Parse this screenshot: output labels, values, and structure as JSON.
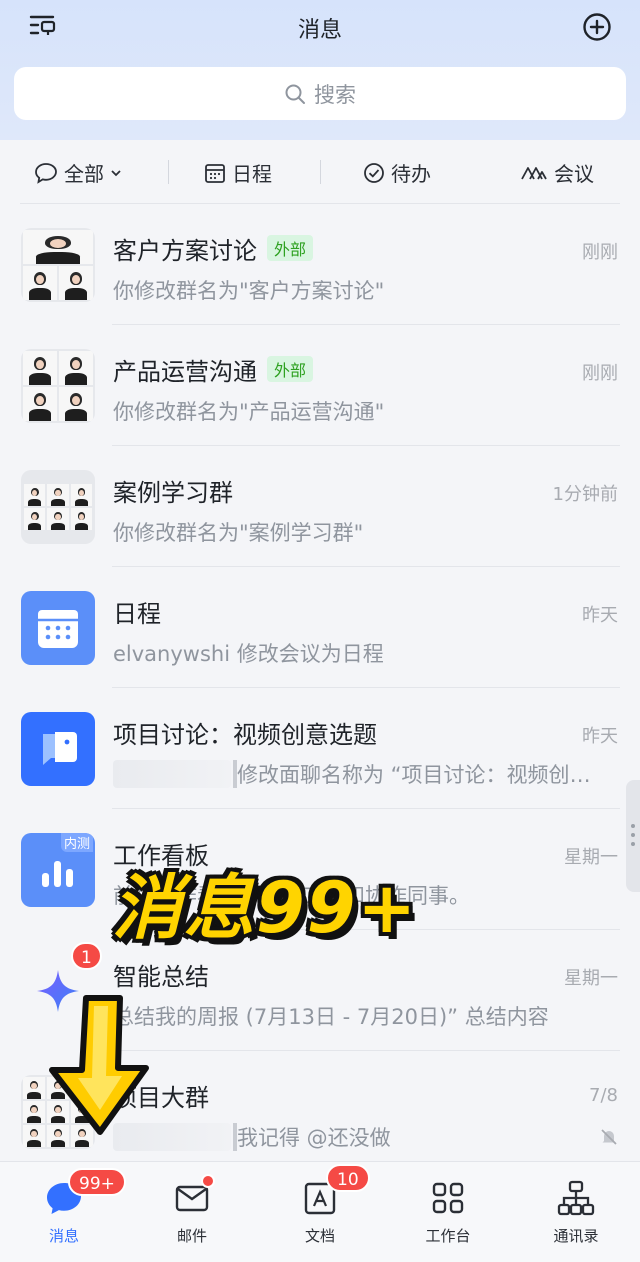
{
  "header": {
    "title": "消息",
    "search_placeholder": "搜索"
  },
  "filters": [
    {
      "label": "全部",
      "icon": "chat-bubble-icon"
    },
    {
      "label": "日程",
      "icon": "calendar-icon"
    },
    {
      "label": "待办",
      "icon": "check-circle-icon"
    },
    {
      "label": "会议",
      "icon": "meeting-icon"
    }
  ],
  "chats": [
    {
      "name": "客户方案讨论",
      "tag": "外部",
      "time": "刚刚",
      "preview": "你修改群名为\"客户方案讨论\""
    },
    {
      "name": "产品运营沟通",
      "tag": "外部",
      "time": "刚刚",
      "preview": "你修改群名为\"产品运营沟通\""
    },
    {
      "name": "案例学习群",
      "time": "1分钟前",
      "preview": "你修改群名为\"案例学习群\""
    },
    {
      "name": "日程",
      "time": "昨天",
      "preview": "elvanywshi 修改会议为日程"
    },
    {
      "name": "项目讨论：视频创意选题",
      "time": "昨天",
      "preview": "修改面聊名称为 “项目讨论：视频创意选题”"
    },
    {
      "name": "工作看板",
      "avatar_badge": "内测",
      "time": "星期一",
      "preview": "前往工作看板，了解工作和协作同事。"
    },
    {
      "name": "智能总结",
      "unread": "1",
      "time": "星期一",
      "preview": "总结我的周报 (7月13日 - 7月20日)” 总结内容"
    },
    {
      "name": "项目大群",
      "time": "7/8",
      "preview": "我记得 @还没做"
    }
  ],
  "overlay": {
    "promo_text": "消息99+"
  },
  "bottom_nav": [
    {
      "label": "消息",
      "badge": "99+",
      "active": true
    },
    {
      "label": "邮件",
      "dot": true
    },
    {
      "label": "文档",
      "badge": "10"
    },
    {
      "label": "工作台"
    },
    {
      "label": "通讯录"
    }
  ],
  "colors": {
    "accent": "#3370ff",
    "badge_red": "#f54a45",
    "external_tag_bg": "#d9f5e1",
    "external_tag_text": "#2ea121",
    "promo_yellow": "#ffd400"
  }
}
